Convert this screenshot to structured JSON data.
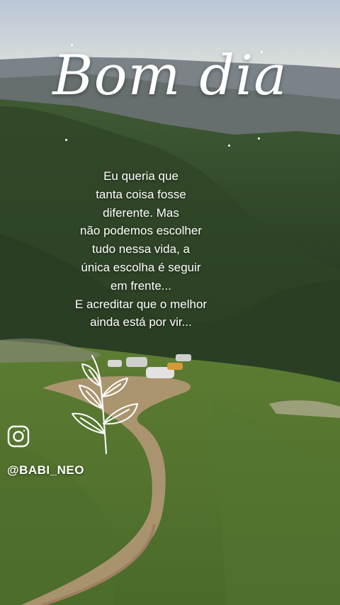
{
  "greeting": "Bom dia",
  "message": "Eu queria que\ntanta coisa fosse\ndiferente.  Mas\nnão podemos escolher\ntudo nessa vida, a\núnica escolha é seguir\nem frente...\nE acreditar que o melhor\nainda está por vir...",
  "social": {
    "icon": "instagram-icon",
    "handle": "@BABI_NEO"
  },
  "colors": {
    "text": "#ffffff",
    "sky": "#c9d3dc",
    "grass": "#5c7a32",
    "road": "#b89a7a"
  }
}
